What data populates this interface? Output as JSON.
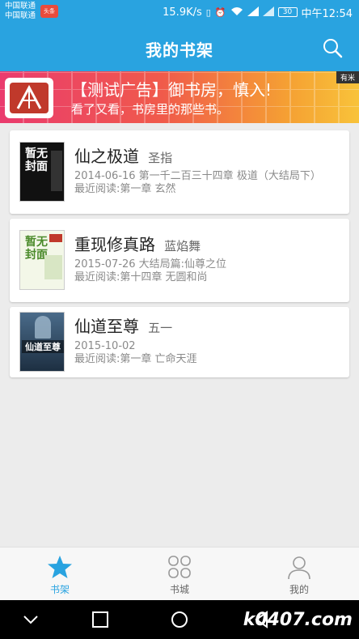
{
  "status_bar": {
    "carrier_line1": "中国联通",
    "carrier_line2": "中国联通",
    "carrier_badge": "头条",
    "speed": "15.9K/s",
    "battery": "30",
    "time": "中午12:54"
  },
  "header": {
    "title": "我的书架",
    "search_icon": "search-icon"
  },
  "ad": {
    "title": "【测试广告】御书房，慎入!",
    "subtitle": "看了又看，书房里的那些书。",
    "tag": "有米"
  },
  "books": [
    {
      "title": "仙之极道",
      "author": "圣指",
      "update": "2014-06-16  第一千二百三十四章 极道（大结局下）",
      "recent": "最近阅读:第一章 玄然",
      "cover_text": "暂无封面"
    },
    {
      "title": "重现修真路",
      "author": "蓝焰舞",
      "update": "2015-07-26  大结局篇:仙尊之位",
      "recent": "最近阅读:第十四章 无圆和尚",
      "cover_text": "暂无封面"
    },
    {
      "title": "仙道至尊",
      "author": "五一",
      "update": "2015-10-02",
      "recent": "最近阅读:第一章 亡命天涯",
      "cover_text": "仙道至尊"
    }
  ],
  "tabs": [
    {
      "label": "书架",
      "icon": "star-icon",
      "active": true
    },
    {
      "label": "书城",
      "icon": "grid-icon",
      "active": false
    },
    {
      "label": "我的",
      "icon": "user-icon",
      "active": false
    }
  ],
  "nav": {
    "watermark": "k0407.com"
  },
  "colors": {
    "primary": "#29a3e0",
    "background": "#ececec"
  }
}
